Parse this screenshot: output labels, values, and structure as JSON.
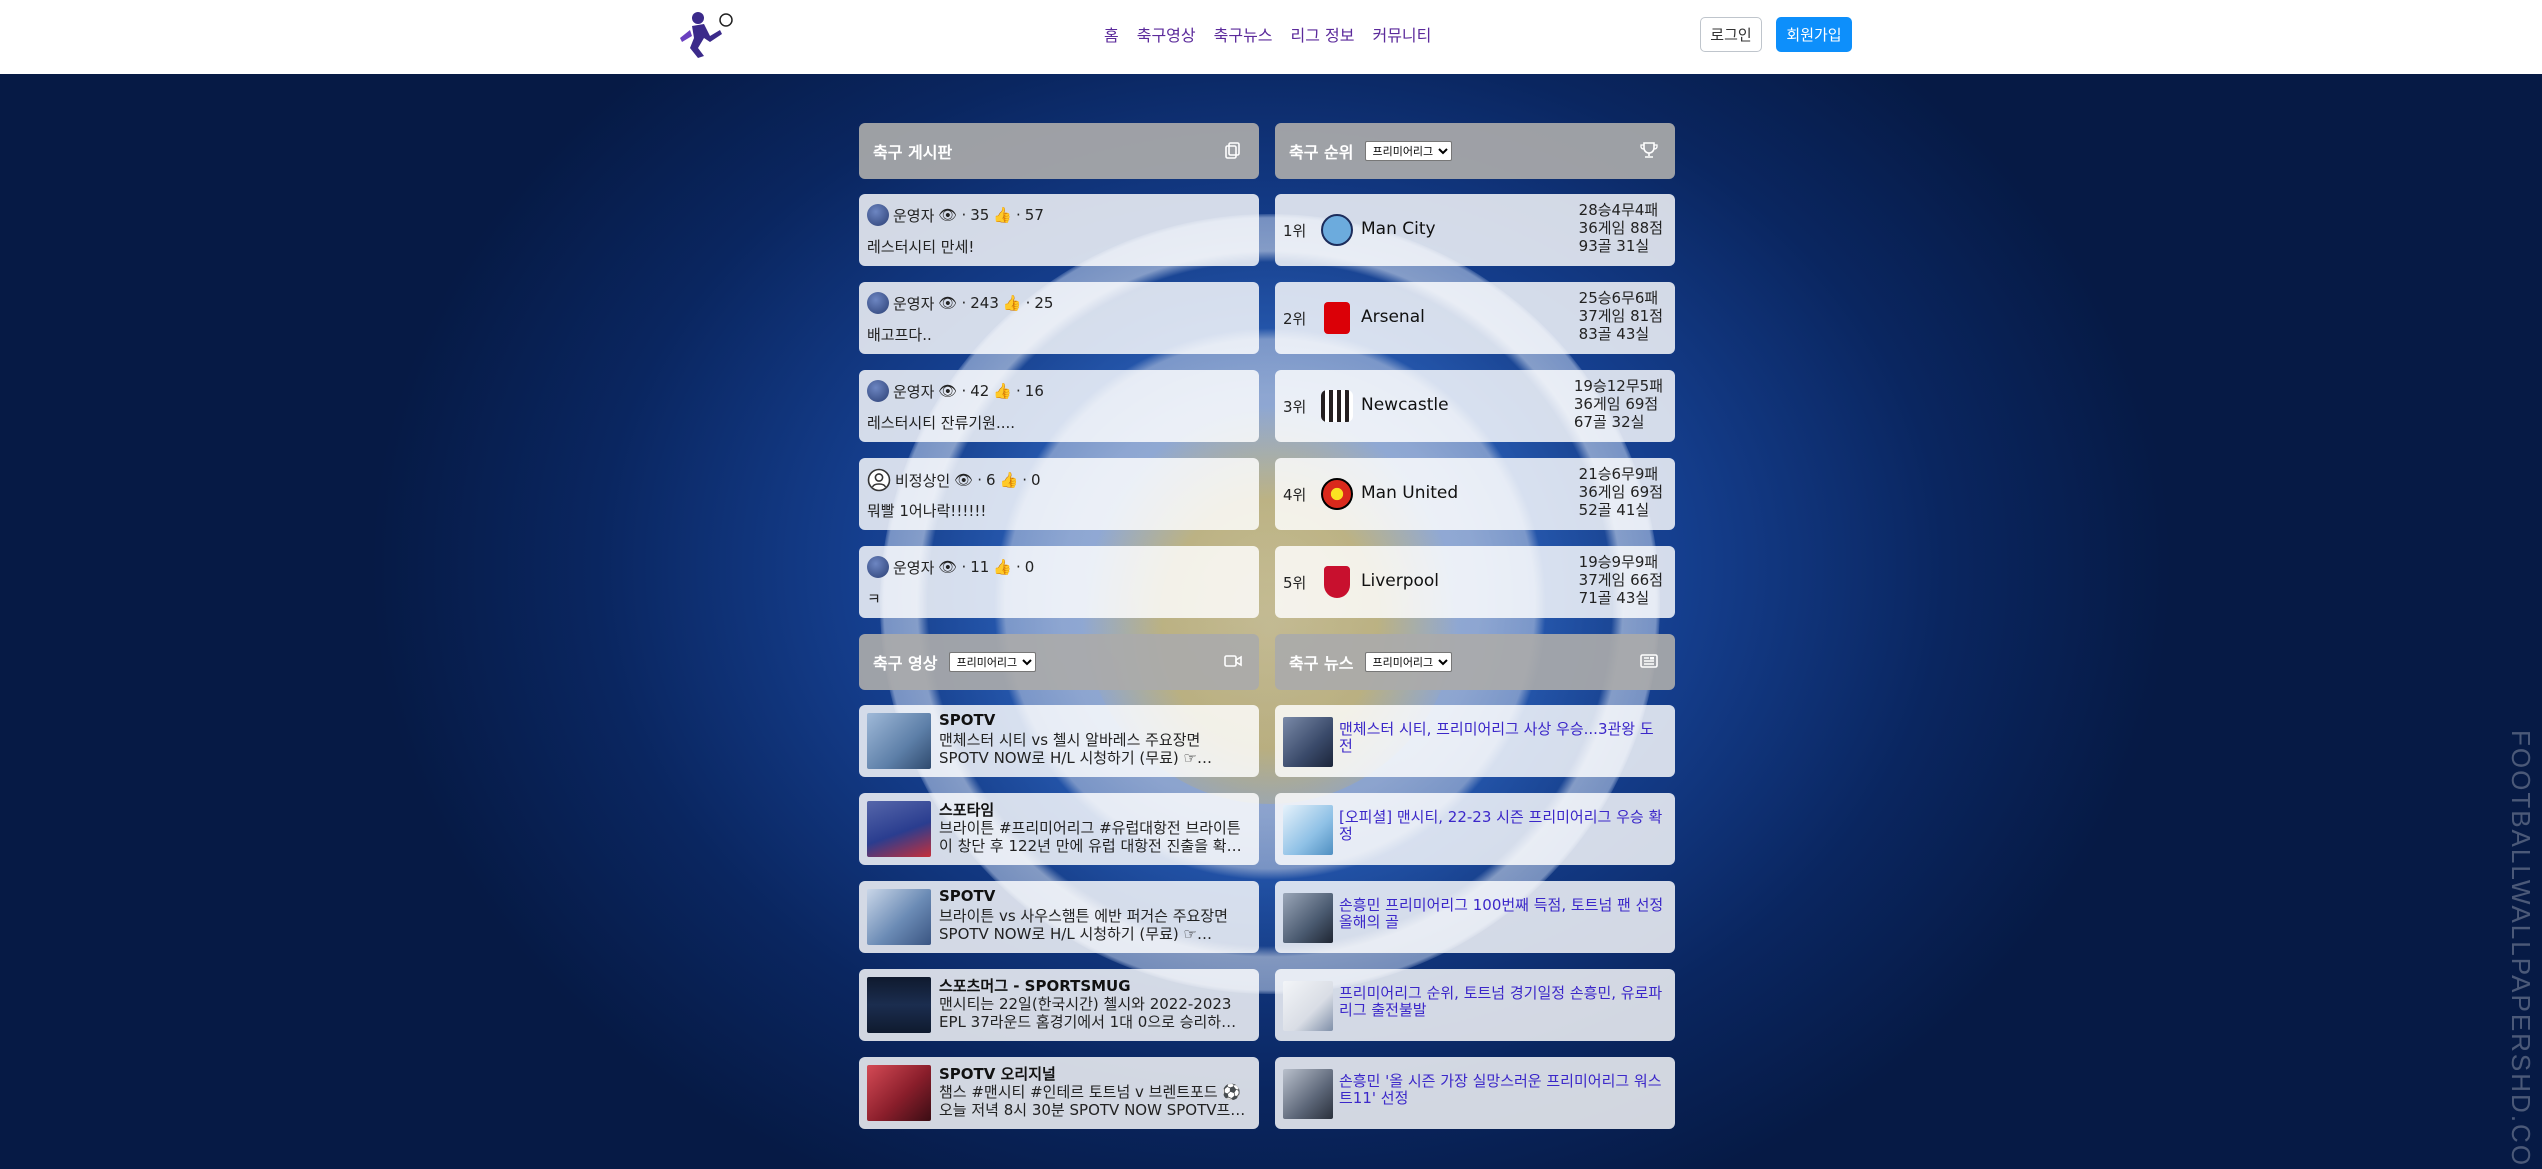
{
  "navbar": {
    "links": [
      "홈",
      "축구영상",
      "축구뉴스",
      "리그 정보",
      "커뮤니티"
    ],
    "login_label": "로그인",
    "signup_label": "회원가입"
  },
  "colors": {
    "signup_button": "#0d8ffb",
    "nav_link": "#5b2a9b",
    "panel_header": "#aaaaaa",
    "news_link": "#3b27c9"
  },
  "board": {
    "title": "축구 게시판",
    "icon": "copy-icon",
    "posts": [
      {
        "author": "운영자",
        "views": "35",
        "likes": "57",
        "text": "레스터시티 만세!",
        "avatar": "photo"
      },
      {
        "author": "운영자",
        "views": "243",
        "likes": "25",
        "text": "배고프다..",
        "avatar": "photo"
      },
      {
        "author": "운영자",
        "views": "42",
        "likes": "16",
        "text": "레스터시티 잔류기원....",
        "avatar": "photo"
      },
      {
        "author": "비정상인",
        "views": "6",
        "likes": "0",
        "text": "뭐빨 1어나락!!!!!!",
        "avatar": "default"
      },
      {
        "author": "운영자",
        "views": "11",
        "likes": "0",
        "text": "ㅋ",
        "avatar": "photo"
      }
    ]
  },
  "standings": {
    "title": "축구 순위",
    "league_select": "프리미어리그",
    "icon": "trophy-icon",
    "teams": [
      {
        "rank": "1위",
        "name": "Man City",
        "record": "28승4무4패",
        "games_points": "36게임 88점",
        "goals": "93골 31실",
        "crest_color": "#6cabdd"
      },
      {
        "rank": "2위",
        "name": "Arsenal",
        "record": "25승6무6패",
        "games_points": "37게임 81점",
        "goals": "83골 43실",
        "crest_color": "#db0007"
      },
      {
        "rank": "3위",
        "name": "Newcastle",
        "record": "19승12무5패",
        "games_points": "36게임 69점",
        "goals": "67골 32실",
        "crest_color": "#241f20"
      },
      {
        "rank": "4위",
        "name": "Man United",
        "record": "21승6무9패",
        "games_points": "36게임 69점",
        "goals": "52골 41실",
        "crest_color": "#da291c"
      },
      {
        "rank": "5위",
        "name": "Liverpool",
        "record": "19승9무9패",
        "games_points": "37게임 66점",
        "goals": "71골 43실",
        "crest_color": "#c8102e"
      }
    ]
  },
  "videos": {
    "title": "축구 영상",
    "league_select": "프리미어리그",
    "icon": "video-icon",
    "items": [
      {
        "channel": "SPOTV",
        "line1": "맨체스터 시티 vs 첼시 알바레스 주요장면",
        "line2": "SPOTV NOW로 H/L 시청하기 (무료) ☞…",
        "thumb_color": "#5d7fa8"
      },
      {
        "channel": "스포타임",
        "line1": "브라이튼 #프리미어리그 #유럽대항전 브라이튼",
        "line2": "이 창단 후 122년 만에 유럽 대항전 진출을 확…",
        "thumb_color": "#2a3d8f"
      },
      {
        "channel": "SPOTV",
        "line1": "브라이튼 vs 사우스햄튼 에반 퍼거슨 주요장면",
        "line2": "SPOTV NOW로 H/L 시청하기 (무료) ☞…",
        "thumb_color": "#6b8bb5"
      },
      {
        "channel": "스포츠머그 - SPORTSMUG",
        "line1": "맨시티는 22일(한국시간) 첼시와 2022-2023",
        "line2": "EPL 37라운드 홈경기에서 1대 0으로 승리하며…",
        "thumb_color": "#1b2d4f"
      },
      {
        "channel": "SPOTV 오리지널",
        "line1": "챔스 #맨시티 #인테르 토트넘 v 브렌트포드 ⚽",
        "line2": "오늘 저녁 8시 30분 SPOTV NOW SPOTV프…",
        "thumb_color": "#8a1e2b"
      }
    ]
  },
  "news": {
    "title": "축구 뉴스",
    "league_select": "프리미어리그",
    "icon": "newspaper-icon",
    "items": [
      {
        "headline": "맨체스터 시티, 프리미어리그 사상 우승...3관왕 도전",
        "thumb_color": "#3a4a6a"
      },
      {
        "headline": "[오피셜] 맨시티, 22-23 시즌 프리미어리그 우승 확정",
        "thumb_color": "#8fc1e6"
      },
      {
        "headline": "손흥민 프리미어리그 100번째 득점, 토트넘 팬 선정 올해의 골",
        "thumb_color": "#4a5a70"
      },
      {
        "headline": "프리미어리그 순위, 토트넘 경기일정 손흥민, 유로파리그 출전불발",
        "thumb_color": "#d9dde5"
      },
      {
        "headline": "손흥민 '올 시즌 가장 실망스러운 프리미어리그 워스트11' 선정",
        "thumb_color": "#5c6678"
      }
    ]
  },
  "watermark": "FOOTBALLWALLPAPERSHD.COM"
}
